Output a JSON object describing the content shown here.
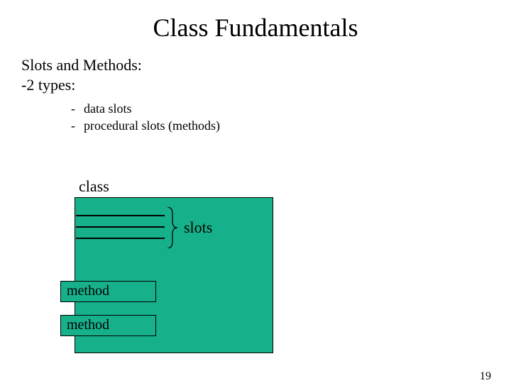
{
  "title": "Class Fundamentals",
  "subtitle_line1": "Slots and Methods:",
  "subtitle_line2": "-2 types:",
  "bullets": {
    "b1": "data slots",
    "b2": "procedural slots (methods)"
  },
  "diagram": {
    "class_label": "class",
    "slots_label": "slots",
    "method_label_1": "method",
    "method_label_2": "method"
  },
  "page_number": "19"
}
